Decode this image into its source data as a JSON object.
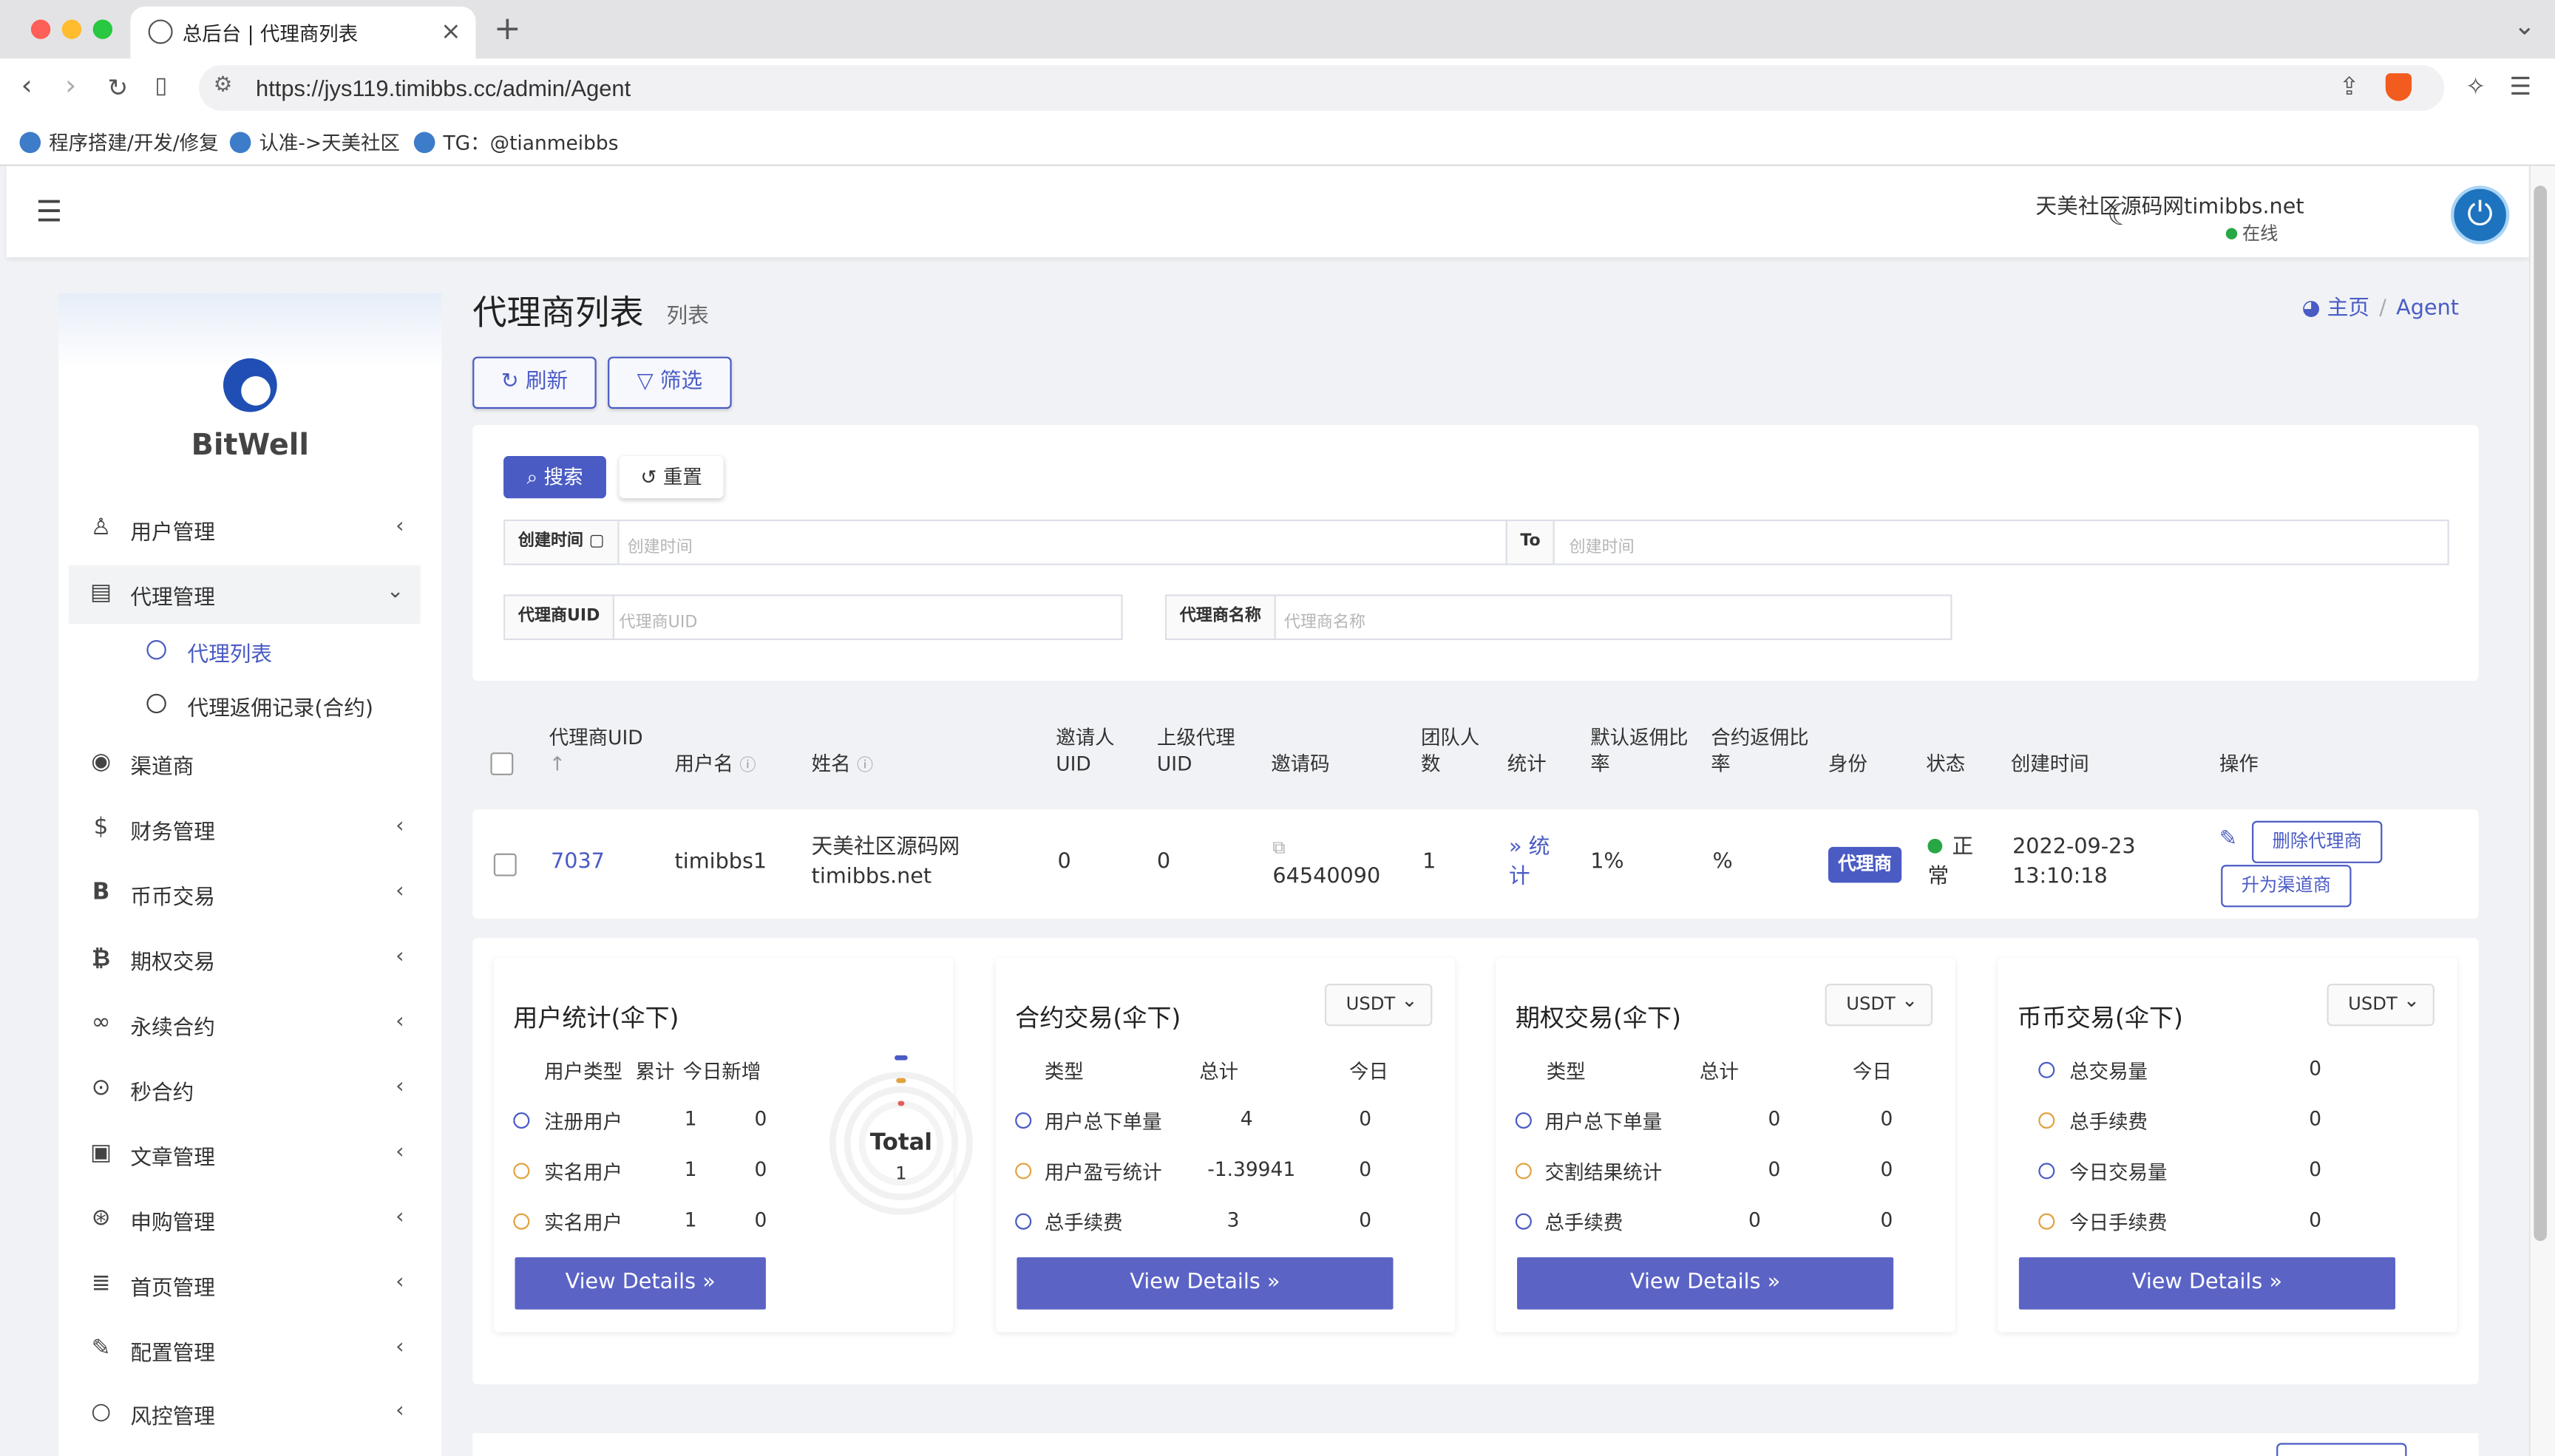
{
  "browser": {
    "tab_title": "总后台 | 代理商列表",
    "url": "https://jys119.timibbs.cc/admin/Agent",
    "bookmarks": [
      "程序搭建/开发/修复",
      "认准->天美社区",
      "TG：@tianmeibbs"
    ]
  },
  "header": {
    "username": "天美社区源码网timibbs.net",
    "status": "在线"
  },
  "sidebar": {
    "brand": "BitWell",
    "items": [
      {
        "label": "用户管理",
        "icon": "user-icon"
      },
      {
        "label": "代理管理",
        "icon": "id-card-icon"
      },
      {
        "label": "渠道商",
        "icon": "user-circle-icon"
      },
      {
        "label": "财务管理",
        "icon": "dollar-icon"
      },
      {
        "label": "币币交易",
        "icon": "b-icon"
      },
      {
        "label": "期权交易",
        "icon": "bitcoin-icon"
      },
      {
        "label": "永续合约",
        "icon": "link-icon"
      },
      {
        "label": "秒合约",
        "icon": "dot-circle-icon"
      },
      {
        "label": "文章管理",
        "icon": "newspaper-icon"
      },
      {
        "label": "申购管理",
        "icon": "lifebuoy-icon"
      },
      {
        "label": "首页管理",
        "icon": "list-icon"
      },
      {
        "label": "配置管理",
        "icon": "wrench-icon"
      },
      {
        "label": "风控管理",
        "icon": "circle-icon"
      }
    ],
    "sub_items": [
      "代理列表",
      "代理返佣记录(合约)"
    ]
  },
  "page": {
    "title": "代理商列表",
    "subtitle": "列表",
    "breadcrumb_home": "主页",
    "breadcrumb_current": "Agent",
    "refresh": "刷新",
    "filter": "筛选"
  },
  "filter": {
    "search": "搜索",
    "reset": "重置",
    "created_label": "创建时间",
    "created_ph": "创建时间",
    "to": "To",
    "created_ph2": "创建时间",
    "uid_label": "代理商UID",
    "uid_ph": "代理商UID",
    "name_label": "代理商名称",
    "name_ph": "代理商名称"
  },
  "table": {
    "headers": {
      "uid": "代理商UID",
      "username": "用户名",
      "name": "姓名",
      "inviter": "邀请人UID",
      "parent": "上级代理UID",
      "code": "邀请码",
      "team": "团队人数",
      "stats": "统计",
      "rebate": "默认返佣比率",
      "contract_rebate": "合约返佣比率",
      "role": "身份",
      "status": "状态",
      "created": "创建时间",
      "ops": "操作"
    },
    "row": {
      "uid": "7037",
      "username": "timibbs1",
      "name_line1": "天美社区源码网",
      "name_line2": "timibbs.net",
      "inviter": "0",
      "parent": "0",
      "code": "64540090",
      "team": "1",
      "stats_link": "统计",
      "rebate": "1%",
      "contract_rebate": "%",
      "role": "代理商",
      "status": "正常",
      "created_date": "2022-09-23",
      "created_time": "13:10:18",
      "delete_btn": "删除代理商",
      "promote_btn": "升为渠道商"
    }
  },
  "cards": {
    "user": {
      "title": "用户统计(伞下)",
      "headers": [
        "用户类型",
        "累计",
        "今日新增"
      ],
      "rows": [
        {
          "label": "注册用户",
          "total": "1",
          "today": "0"
        },
        {
          "label": "实名用户",
          "total": "1",
          "today": "0"
        },
        {
          "label": "实名用户",
          "total": "1",
          "today": "0"
        }
      ],
      "donut_label": "Total",
      "donut_value": "1",
      "details": "View Details"
    },
    "contract": {
      "title": "合约交易(伞下)",
      "currency": "USDT",
      "headers": [
        "类型",
        "总计",
        "今日"
      ],
      "rows": [
        {
          "label": "用户总下单量",
          "total": "4",
          "today": "0"
        },
        {
          "label": "用户盈亏统计",
          "total": "-1.39941",
          "today": "0"
        },
        {
          "label": "总手续费",
          "total": "3",
          "today": "0"
        }
      ],
      "details": "View Details"
    },
    "option": {
      "title": "期权交易(伞下)",
      "currency": "USDT",
      "headers": [
        "类型",
        "总计",
        "今日"
      ],
      "rows": [
        {
          "label": "用户总下单量",
          "total": "0",
          "today": "0"
        },
        {
          "label": "交割结果统计",
          "total": "0",
          "today": "0"
        },
        {
          "label": "总手续费",
          "total": "0",
          "today": "0"
        }
      ],
      "details": "View Details"
    },
    "spot": {
      "title": "币币交易(伞下)",
      "currency": "USDT",
      "rows": [
        {
          "label": "总交易量",
          "value": "0"
        },
        {
          "label": "总手续费",
          "value": "0"
        },
        {
          "label": "今日交易量",
          "value": "0"
        },
        {
          "label": "今日手续费",
          "value": "0"
        }
      ],
      "details": "View Details"
    }
  },
  "colors": {
    "primary": "#4a5bc4",
    "button": "#5b64c5",
    "ring_orange": "#e1a23f",
    "online": "#28a745"
  }
}
